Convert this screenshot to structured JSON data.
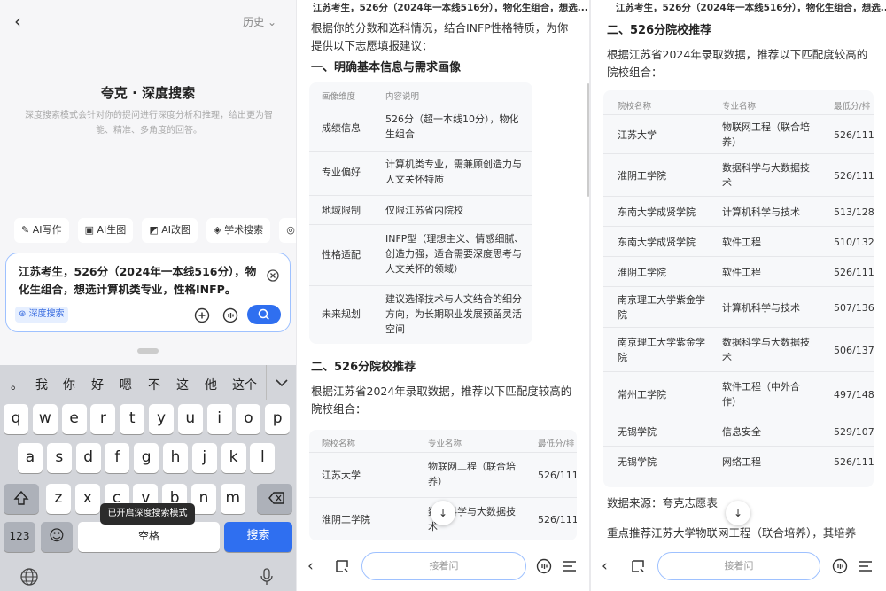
{
  "left": {
    "history_label": "历史",
    "title": "夸克 · 深度搜索",
    "description": "深度搜索模式会针对你的提问进行深度分析和推理，给出更为智能、精准、多角度的回答。",
    "chips": [
      "AI写作",
      "AI生图",
      "AI改图",
      "学术搜索"
    ],
    "input_text": "江苏考生，526分（2024年一本线516分），物化生组合，想选计算机类专业，性格INFP。",
    "deep_tag": "深度搜索",
    "toast": "已开启深度搜索模式",
    "keyboard": {
      "candidates": [
        "。",
        "我",
        "你",
        "好",
        "嗯",
        "不",
        "这",
        "他",
        "这个"
      ],
      "row1": [
        "q",
        "w",
        "e",
        "r",
        "t",
        "y",
        "u",
        "i",
        "o",
        "p"
      ],
      "row2": [
        "a",
        "s",
        "d",
        "f",
        "g",
        "h",
        "j",
        "k",
        "l"
      ],
      "row3": [
        "z",
        "x",
        "c",
        "v",
        "b",
        "n",
        "m"
      ],
      "numbers_key": "123",
      "space_key": "空格",
      "search_key": "搜索"
    }
  },
  "middle": {
    "question": "江苏考生，526分（2024年一本线516分），物化生组合，想选...",
    "intro": "根据你的分数和选科情况，结合INFP性格特质，为你提供以下志愿填报建议：",
    "section1": "一、明确基本信息与需求画像",
    "table1": {
      "headers": [
        "画像维度",
        "内容说明"
      ],
      "rows": [
        {
          "dim": "成绩信息",
          "desc": "526分（超一本线10分），物化生组合"
        },
        {
          "dim": "专业偏好",
          "desc": "计算机类专业，需兼顾创造力与人文关怀特质"
        },
        {
          "dim": "地域限制",
          "desc": "仅限江苏省内院校"
        },
        {
          "dim": "性格适配",
          "desc": "INFP型（理想主义、情感细腻、创造力强，适合需要深度思考与人文关怀的领域）"
        },
        {
          "dim": "未来规划",
          "desc": "建议选择技术与人文结合的细分方向，为长期职业发展预留灵活空间"
        }
      ]
    },
    "section2": "二、526分院校推荐",
    "intro2": "根据江苏省2024年录取数据，推荐以下匹配度较高的院校组合：",
    "table2": {
      "headers": [
        "院校名称",
        "专业名称",
        "最低分/排"
      ],
      "rows": [
        {
          "school": "江苏大学",
          "major": "物联网工程（联合培养）",
          "score": "526/111"
        },
        {
          "school": "淮阴工学院",
          "major": "数据科学与大数据技术",
          "score": "526/111"
        }
      ]
    },
    "ask_placeholder": "接着问"
  },
  "right": {
    "question": "江苏考生，526分（2024年一本线516分），物化生组合，想选...",
    "section2": "二、526分院校推荐",
    "intro2": "根据江苏省2024年录取数据，推荐以下匹配度较高的院校组合：",
    "table": {
      "headers": [
        "院校名称",
        "专业名称",
        "最低分/排"
      ],
      "rows": [
        {
          "school": "江苏大学",
          "major": "物联网工程（联合培养）",
          "score": "526/111"
        },
        {
          "school": "淮阴工学院",
          "major": "数据科学与大数据技术",
          "score": "526/111"
        },
        {
          "school": "东南大学成贤学院",
          "major": "计算机科学与技术",
          "score": "513/128"
        },
        {
          "school": "东南大学成贤学院",
          "major": "软件工程",
          "score": "510/132"
        },
        {
          "school": "淮阴工学院",
          "major": "软件工程",
          "score": "526/111"
        },
        {
          "school": "南京理工大学紫金学院",
          "major": "计算机科学与技术",
          "score": "507/136"
        },
        {
          "school": "南京理工大学紫金学院",
          "major": "数据科学与大数据技术",
          "score": "506/137"
        },
        {
          "school": "常州工学院",
          "major": "软件工程（中外合作）",
          "score": "497/148"
        },
        {
          "school": "无锡学院",
          "major": "信息安全",
          "score": "529/107"
        },
        {
          "school": "无锡学院",
          "major": "网络工程",
          "score": "526/111"
        }
      ]
    },
    "source": "数据来源：夸克志愿表",
    "highlight": "重点推荐江苏大学物联网工程（联合培养），其培养",
    "ask_placeholder": "接着问"
  },
  "colors": {
    "accent": "#2f6ff0",
    "input_border": "#9ec1ff",
    "toast_bg": "#2b2b2b"
  }
}
